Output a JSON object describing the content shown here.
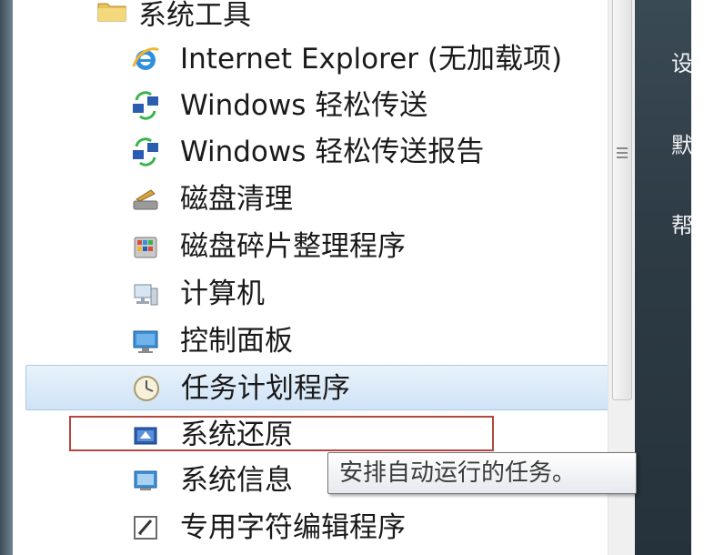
{
  "folder": {
    "label": "系统工具",
    "icon": "folder-icon"
  },
  "items": [
    {
      "label": "Internet Explorer (无加载项)",
      "icon": "internet-explorer-icon"
    },
    {
      "label": "Windows 轻松传送",
      "icon": "easy-transfer-icon"
    },
    {
      "label": "Windows 轻松传送报告",
      "icon": "easy-transfer-report-icon"
    },
    {
      "label": "磁盘清理",
      "icon": "disk-cleanup-icon"
    },
    {
      "label": "磁盘碎片整理程序",
      "icon": "disk-defragmenter-icon"
    },
    {
      "label": "计算机",
      "icon": "computer-icon"
    },
    {
      "label": "控制面板",
      "icon": "control-panel-icon"
    },
    {
      "label": "任务计划程序",
      "icon": "task-scheduler-icon"
    },
    {
      "label": "系统还原",
      "icon": "system-restore-icon"
    },
    {
      "label": "系统信息",
      "icon": "system-information-icon"
    },
    {
      "label": "专用字符编辑程序",
      "icon": "private-character-editor-icon"
    }
  ],
  "tooltip": {
    "text": "安排自动运行的任务。"
  },
  "right_pane": {
    "glyphs": [
      "设",
      "默",
      "帮"
    ]
  },
  "colors": {
    "highlight_top": "#e8f2fb",
    "highlight_bottom": "#cfe3f6",
    "red_outline": "#b4473f",
    "right_pane": "#2e3c46"
  }
}
